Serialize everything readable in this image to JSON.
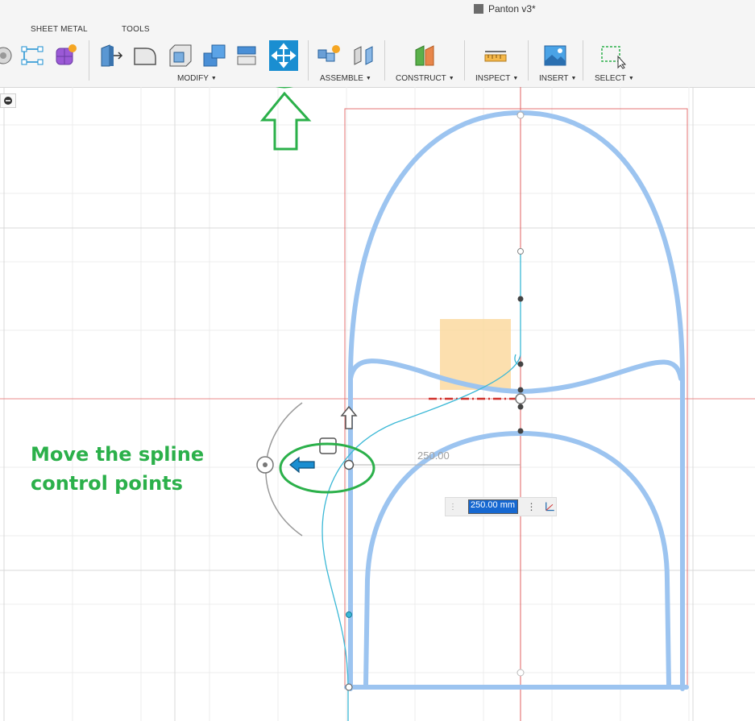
{
  "window": {
    "title": "Panton v3*"
  },
  "tabs": {
    "sheet_metal": "SHEET METAL",
    "tools": "TOOLS"
  },
  "groups": {
    "modify": "MODIFY",
    "assemble": "ASSEMBLE",
    "construct": "CONSTRUCT",
    "inspect": "INSPECT",
    "insert": "INSERT",
    "select": "SELECT"
  },
  "annotation": {
    "line1": "Move the spline",
    "line2": "control points"
  },
  "dimension": {
    "label": "250.00",
    "input_value": "250.00 mm"
  },
  "colors": {
    "annotation_green": "#2bb04a",
    "move_blue": "#1a8ed1",
    "sketch_blue": "#9cc4f0",
    "spline_cyan": "#3bb8d6",
    "axis_red": "#e05050"
  }
}
